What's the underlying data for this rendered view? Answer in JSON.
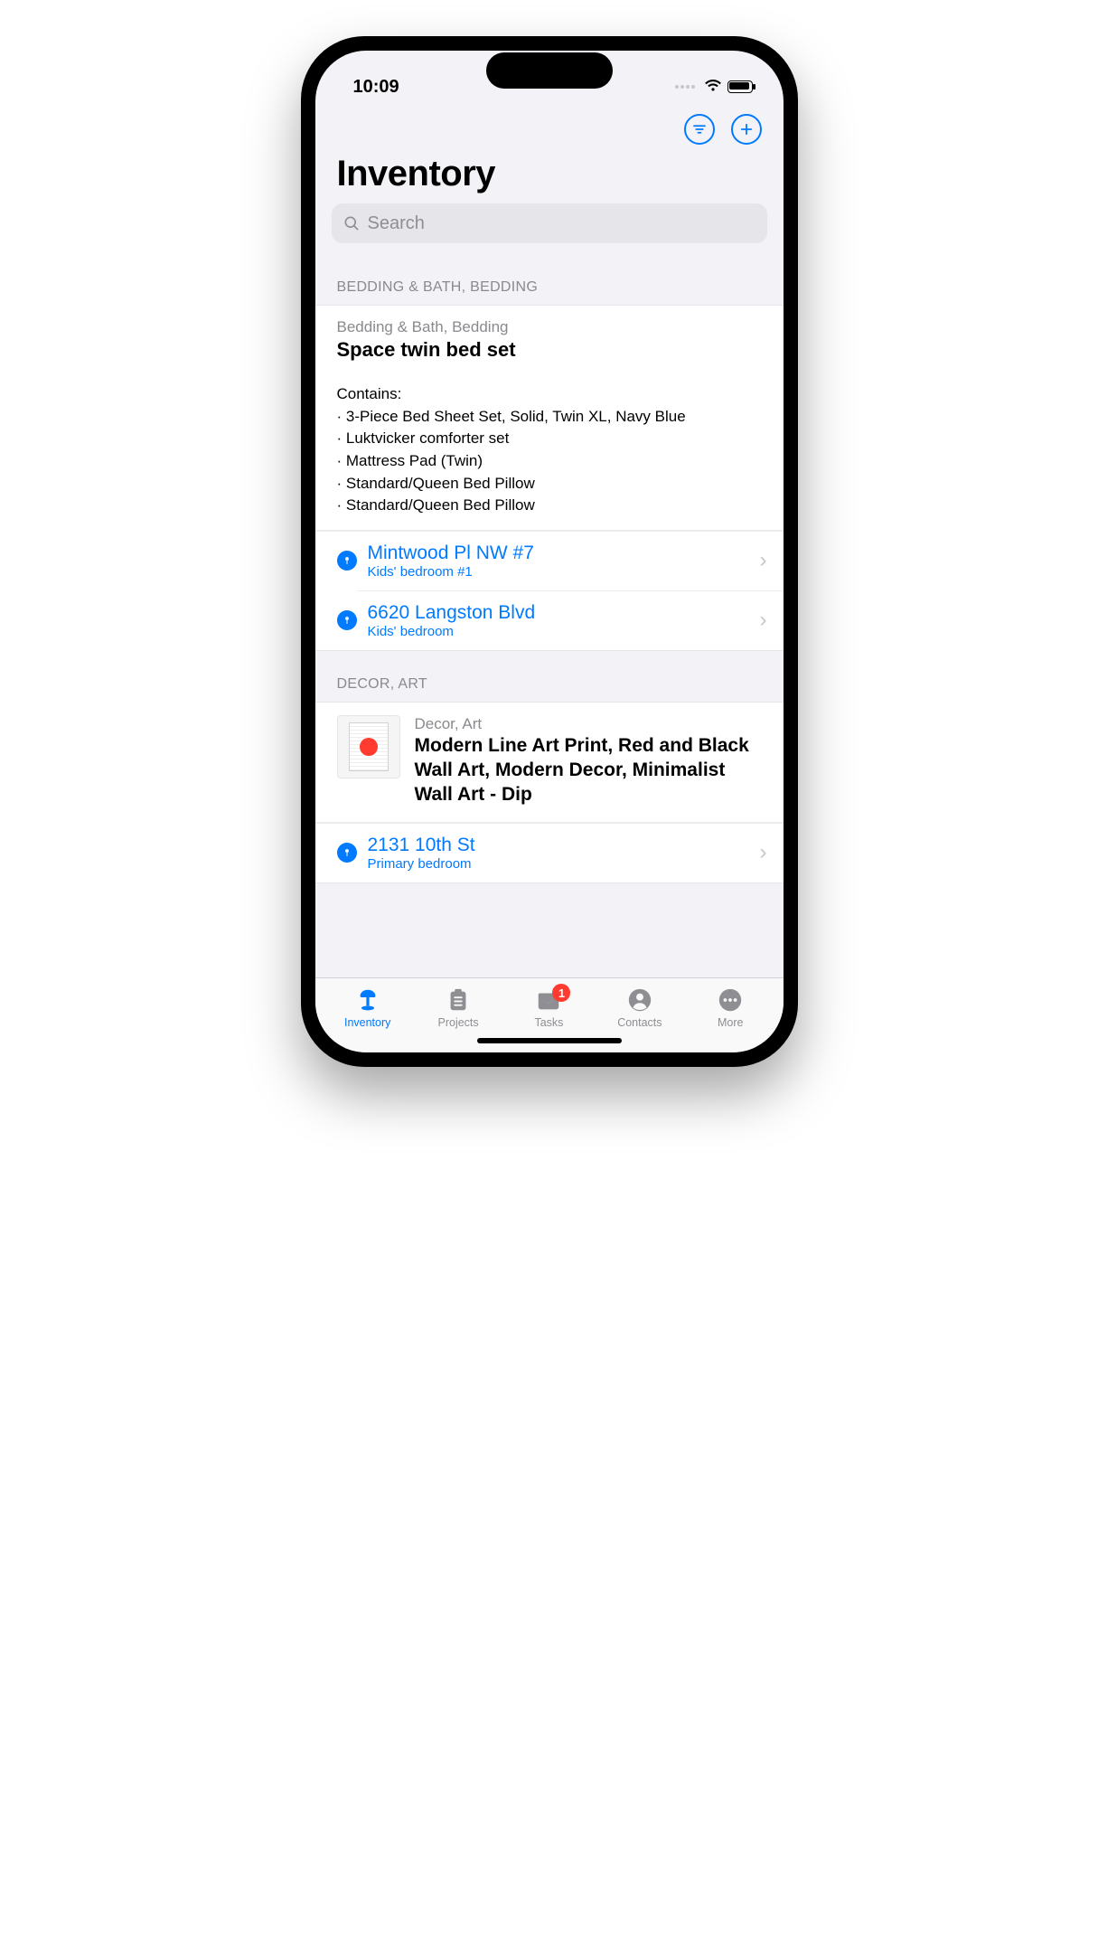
{
  "status": {
    "time": "10:09"
  },
  "header": {
    "title": "Inventory"
  },
  "search": {
    "placeholder": "Search"
  },
  "sections": [
    {
      "header": "BEDDING & BATH, BEDDING",
      "item": {
        "category": "Bedding & Bath, Bedding",
        "title": "Space twin bed set",
        "contains_label": "Contains:",
        "contains": [
          "3-Piece Bed Sheet Set, Solid, Twin XL, Navy Blue",
          "Luktvicker comforter set",
          "Mattress Pad (Twin)",
          "Standard/Queen Bed Pillow",
          "Standard/Queen Bed Pillow"
        ],
        "locations": [
          {
            "address": "Mintwood Pl NW #7",
            "room": "Kids' bedroom #1"
          },
          {
            "address": "6620 Langston Blvd",
            "room": "Kids' bedroom"
          }
        ]
      }
    },
    {
      "header": "DECOR, ART",
      "item": {
        "category": "Decor, Art",
        "title": "Modern Line Art Print, Red and Black Wall Art, Modern Decor, Minimalist Wall Art - Dip",
        "locations": [
          {
            "address": "2131 10th St",
            "room": "Primary bedroom"
          }
        ]
      }
    }
  ],
  "tabbar": {
    "items": [
      {
        "label": "Inventory"
      },
      {
        "label": "Projects"
      },
      {
        "label": "Tasks",
        "badge": "1"
      },
      {
        "label": "Contacts"
      },
      {
        "label": "More"
      }
    ]
  }
}
